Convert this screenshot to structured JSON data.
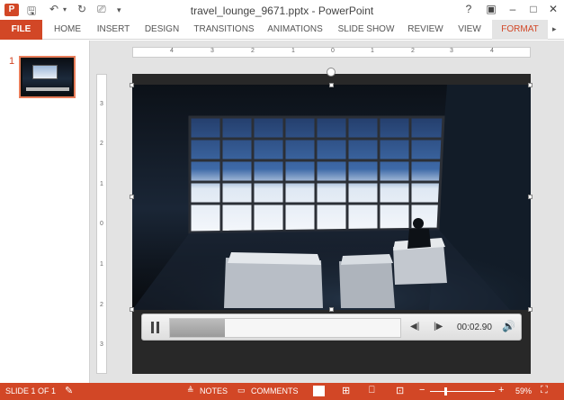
{
  "titlebar": {
    "app_icon": "P",
    "title": "travel_lounge_9671.pptx - PowerPoint",
    "quick_access": [
      "save-icon",
      "undo-icon",
      "redo-icon",
      "slideshow-icon"
    ],
    "controls": {
      "help": "?",
      "ribbon_options": "▣",
      "minimize": "–",
      "maximize": "□",
      "close": "✕"
    }
  },
  "ribbon": {
    "tabs": [
      "FILE",
      "HOME",
      "INSERT",
      "DESIGN",
      "TRANSITIONS",
      "ANIMATIONS",
      "SLIDE SHOW",
      "REVIEW",
      "VIEW",
      "FORMAT"
    ],
    "active_tab": "FORMAT"
  },
  "thumbnails": [
    {
      "number": "1"
    }
  ],
  "rulers": {
    "horizontal": [
      "4",
      "3",
      "2",
      "1",
      "0",
      "1",
      "2",
      "3",
      "4"
    ],
    "vertical": [
      "3",
      "2",
      "1",
      "0",
      "1",
      "2",
      "3"
    ]
  },
  "media_controls": {
    "elapsed": "00:02.90",
    "progress_fraction": 0.24
  },
  "statusbar": {
    "slide_info": "SLIDE 1 OF 1",
    "notes": "NOTES",
    "comments": "COMMENTS",
    "zoom": "59%",
    "zoom_minus": "−",
    "zoom_plus": "+"
  },
  "colors": {
    "accent": "#d24726",
    "format_tab_bg": "#e4e4e4"
  }
}
